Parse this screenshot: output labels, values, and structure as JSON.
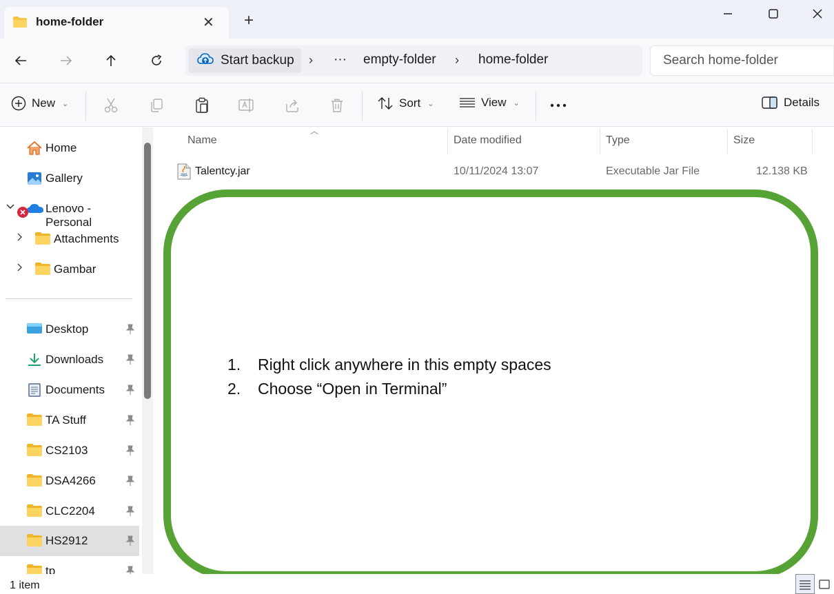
{
  "tab": {
    "title": "home-folder"
  },
  "address": {
    "backup_label": "Start backup",
    "ellipsis": "···",
    "crumbs": [
      "empty-folder",
      "home-folder"
    ]
  },
  "search": {
    "placeholder": "Search home-folder"
  },
  "toolbar": {
    "new_label": "New",
    "sort_label": "Sort",
    "view_label": "View",
    "details_label": "Details"
  },
  "sidebar": {
    "items": [
      {
        "label": "Home",
        "icon": "home-icon"
      },
      {
        "label": "Gallery",
        "icon": "gallery-icon"
      },
      {
        "label": "Lenovo - Personal",
        "icon": "onedrive-cloud-icon"
      },
      {
        "label": "Attachments",
        "icon": "folder-icon"
      },
      {
        "label": "Gambar",
        "icon": "folder-icon"
      },
      {
        "label": "Desktop",
        "icon": "desktop-icon",
        "pinned": true
      },
      {
        "label": "Downloads",
        "icon": "download-icon",
        "pinned": true
      },
      {
        "label": "Documents",
        "icon": "documents-icon",
        "pinned": true
      },
      {
        "label": "TA Stuff",
        "icon": "folder-icon",
        "pinned": true
      },
      {
        "label": "CS2103",
        "icon": "folder-icon",
        "pinned": true
      },
      {
        "label": "DSA4266",
        "icon": "folder-icon",
        "pinned": true
      },
      {
        "label": "CLC2204",
        "icon": "folder-icon",
        "pinned": true
      },
      {
        "label": "HS2912",
        "icon": "folder-icon",
        "pinned": true,
        "selected": true
      },
      {
        "label": "tp",
        "icon": "folder-icon",
        "pinned": true
      }
    ]
  },
  "columns": {
    "name": "Name",
    "date": "Date modified",
    "type": "Type",
    "size": "Size"
  },
  "files": [
    {
      "name": "Talentcy.jar",
      "date": "10/11/2024 13:07",
      "type": "Executable Jar File",
      "size": "12.138 KB",
      "icon": "java-jar-icon"
    }
  ],
  "annotation": {
    "color": "#56a235",
    "steps": [
      {
        "num": "1.",
        "text": "Right click anywhere in this empty spaces"
      },
      {
        "num": "2.",
        "text": "Choose “Open in Terminal”"
      }
    ]
  },
  "status": {
    "item_count": "1 item"
  },
  "colors": {
    "accent": "#0067c0",
    "folder": "#f5c542",
    "selected_bg": "#e0e0e3"
  }
}
